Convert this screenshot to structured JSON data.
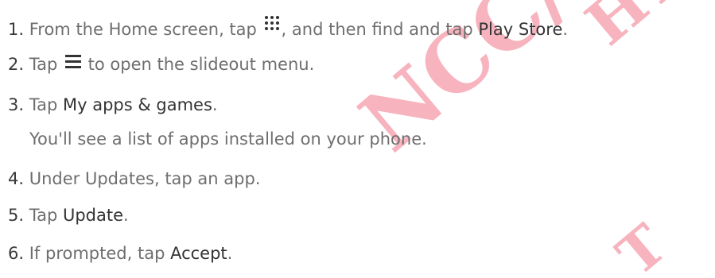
{
  "watermark": {
    "primary": "NCC/CE/FCC",
    "secondary": "HTC",
    "tertiary": "T"
  },
  "colors": {
    "body_text": "#6e6e6e",
    "emphasis_text": "#333333",
    "watermark": "#f7b3be"
  },
  "steps": [
    {
      "number": "1.",
      "text_before": "From the Home screen, tap",
      "icon": "app-grid-icon",
      "text_middle": ", and then find and tap",
      "emphasis": "Play Store",
      "text_after": "."
    },
    {
      "number": "2.",
      "text_before": "Tap",
      "icon": "menu-icon",
      "text_after": "to open the slideout menu."
    },
    {
      "number": "3.",
      "text_before": "Tap",
      "emphasis": "My apps & games",
      "text_after": ".",
      "note": "You'll see a list of apps installed on your phone."
    },
    {
      "number": "4.",
      "text": "Under Updates, tap an app."
    },
    {
      "number": "5.",
      "text_before": "Tap",
      "emphasis": "Update",
      "text_after": "."
    },
    {
      "number": "6.",
      "text_before": "If prompted, tap",
      "emphasis": "Accept",
      "text_after": "."
    }
  ]
}
